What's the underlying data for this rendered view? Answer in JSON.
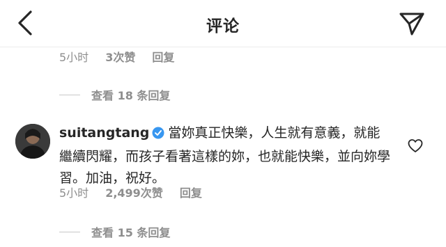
{
  "header": {
    "title": "评论"
  },
  "prev_comment": {
    "time": "5小时",
    "likes": "3次赞",
    "reply": "回复"
  },
  "view_replies_1": "查看 18 条回复",
  "comment": {
    "username": "suitangtang",
    "text": "當妳真正快樂，人生就有意義，就能繼續閃耀，而孩子看著這樣的妳，也就能快樂，並向妳學習。加油，祝好。",
    "time": "5小时",
    "likes": "2,499次赞",
    "reply": "回复"
  },
  "view_replies_2": "查看 15 条回复",
  "icons": {
    "back": "chevron-left-icon",
    "share": "paper-plane-icon",
    "verified": "verified-badge-icon",
    "like": "heart-outline-icon"
  },
  "colors": {
    "text": "#262626",
    "muted": "#8e8e8e",
    "verified": "#3897f0"
  }
}
